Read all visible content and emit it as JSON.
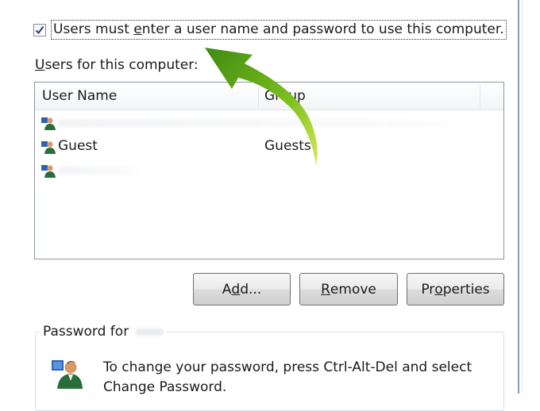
{
  "dialog": {
    "require_login": {
      "checked": true,
      "label_before": "Users must ",
      "label_mnemonic": "e",
      "label_after": "nter a user name and password to use this computer."
    },
    "users_section": {
      "label_mnemonic": "U",
      "label_rest": "sers for this computer:"
    },
    "users_list": {
      "columns": [
        {
          "label": "User Name"
        },
        {
          "label": "Group"
        }
      ],
      "rows": [
        {
          "name": "",
          "group": "",
          "icon": "user-icon"
        },
        {
          "name": "Guest",
          "group": "Guests",
          "icon": "user-icon"
        },
        {
          "name": "",
          "group": "",
          "icon": "user-icon"
        }
      ]
    },
    "buttons": {
      "add": {
        "before": "A",
        "mnemonic": "d",
        "after": "d..."
      },
      "remove": {
        "before": "",
        "mnemonic": "R",
        "after": "emove"
      },
      "properties": {
        "before": "Pr",
        "mnemonic": "o",
        "after": "perties"
      }
    },
    "password_group": {
      "legend": "Password for",
      "line1": "To change your password, press Ctrl-Alt-Del and select",
      "line2": "Change Password."
    }
  },
  "annotation": {
    "type": "curved-arrow",
    "color": "#5a9e12",
    "points_to": "require-login-checkbox"
  }
}
